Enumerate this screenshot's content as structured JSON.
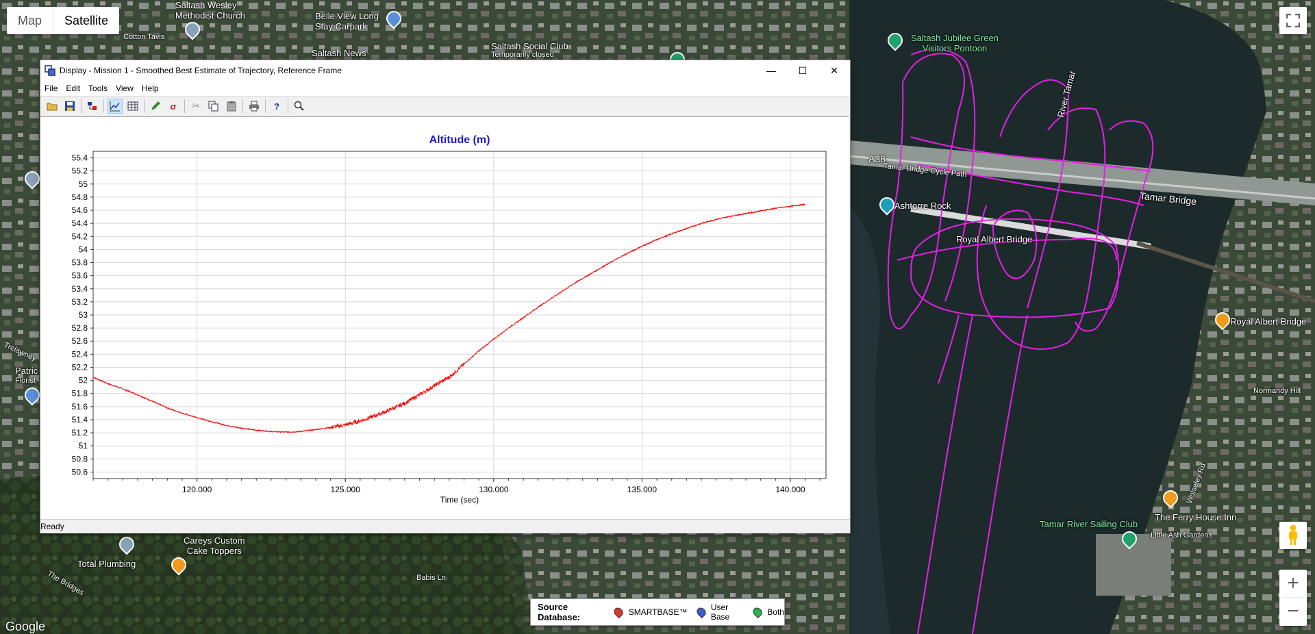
{
  "map": {
    "type_buttons": [
      "Map",
      "Satellite"
    ],
    "attribution": "Google",
    "track_color": "#e81ee8",
    "labels": [
      {
        "text": "Saltash Wesley\nMethodist Church",
        "cls": ""
      },
      {
        "text": "Belle View Long\nStay Carpark",
        "cls": ""
      },
      {
        "text": "Saltash Social Club",
        "cls": ""
      },
      {
        "text": "Temporarily closed",
        "cls": "small"
      },
      {
        "text": "Saltash News",
        "cls": ""
      },
      {
        "text": "Saltash Jubilee Green\nVisitors Pontoon",
        "cls": "green"
      },
      {
        "text": "A38",
        "cls": "road"
      },
      {
        "text": "Tamar Bridge Cycle Path",
        "cls": "small"
      },
      {
        "text": "Tamar Bridge",
        "cls": "road"
      },
      {
        "text": "Ashtorre Rock",
        "cls": ""
      },
      {
        "text": "Royal Albert Bridge",
        "cls": ""
      },
      {
        "text": "River Tamar",
        "cls": ""
      },
      {
        "text": "Royal Albert Bridge",
        "cls": ""
      },
      {
        "text": "Normandy Hill",
        "cls": "small"
      },
      {
        "text": "The Ferry House Inn",
        "cls": ""
      },
      {
        "text": "Tamar River Sailing Club",
        "cls": "green"
      },
      {
        "text": "Little Ash Gardens",
        "cls": "small"
      },
      {
        "text": "Careys Custom\nCake Toppers",
        "cls": ""
      },
      {
        "text": "Total Plumbing",
        "cls": ""
      },
      {
        "text": "Babis Ln",
        "cls": "small"
      },
      {
        "text": "The Bridges",
        "cls": "small"
      },
      {
        "text": "Patric",
        "cls": ""
      },
      {
        "text": "Florist",
        "cls": "small"
      },
      {
        "text": "Trelawney",
        "cls": "small"
      },
      {
        "text": "Wolseley Rd",
        "cls": "small"
      },
      {
        "text": "Cotton Tavis",
        "cls": "small"
      }
    ]
  },
  "legend": {
    "title": "Source Database:",
    "items": [
      {
        "label": "SMARTBASE™",
        "color": "#d9382e"
      },
      {
        "label": "User Base",
        "color": "#3a5fc8"
      },
      {
        "label": "Both",
        "color": "#2fb34a"
      }
    ]
  },
  "window": {
    "title": "Display - Mission 1 - Smoothed Best Estimate of Trajectory, Reference Frame",
    "menu": [
      "File",
      "Edit",
      "Tools",
      "View",
      "Help"
    ],
    "status": "Ready",
    "toolbar_icons": [
      "open-folder-icon",
      "save-icon",
      "layers-icon",
      "line-chart-icon",
      "table-icon",
      "pencil-icon",
      "sigma-icon",
      "cut-icon",
      "copy-icon",
      "paste-icon",
      "print-icon",
      "help-icon",
      "zoom-icon"
    ]
  },
  "chart_data": {
    "type": "line",
    "title": "Altitude (m)",
    "xlabel": "Time (sec)",
    "ylabel": "",
    "xlim": [
      116.5,
      141.2
    ],
    "ylim": [
      50.5,
      55.5
    ],
    "xticks": [
      "120.000",
      "125.000",
      "130.000",
      "135.000",
      "140.000"
    ],
    "xtick_values": [
      120,
      125,
      130,
      135,
      140
    ],
    "yticks": [
      "55.4",
      "55.2",
      "55",
      "54.8",
      "54.6",
      "54.4",
      "54.2",
      "54",
      "53.8",
      "53.6",
      "53.4",
      "53.2",
      "53",
      "52.8",
      "52.6",
      "52.4",
      "52.2",
      "52",
      "51.8",
      "51.6",
      "51.4",
      "51.2",
      "51",
      "50.8",
      "50.6"
    ],
    "ytick_values": [
      55.4,
      55.2,
      55.0,
      54.8,
      54.6,
      54.4,
      54.2,
      54.0,
      53.8,
      53.6,
      53.4,
      53.2,
      53.0,
      52.8,
      52.6,
      52.4,
      52.2,
      52.0,
      51.8,
      51.6,
      51.4,
      51.2,
      51.0,
      50.8,
      50.6
    ],
    "grid": true,
    "series": [
      {
        "color": "#ff0000",
        "x": [
          116.5,
          117.0,
          117.5,
          118.0,
          118.5,
          119.0,
          119.5,
          120.0,
          120.5,
          121.0,
          121.5,
          122.0,
          122.5,
          123.0,
          123.5,
          124.0,
          124.5,
          125.0,
          125.5,
          126.0,
          126.5,
          127.0,
          127.5,
          128.0,
          128.5,
          129.0,
          129.5,
          130.0,
          130.5,
          131.0,
          131.5,
          132.0,
          132.5,
          133.0,
          133.5,
          134.0,
          134.5,
          135.0,
          135.5,
          136.0,
          136.5,
          137.0,
          137.5,
          138.0,
          138.5,
          139.0,
          139.5,
          140.0,
          140.5
        ],
        "y": [
          52.05,
          51.95,
          51.87,
          51.78,
          51.68,
          51.58,
          51.5,
          51.43,
          51.37,
          51.31,
          51.27,
          51.24,
          51.22,
          51.21,
          51.22,
          51.25,
          51.28,
          51.32,
          51.38,
          51.46,
          51.55,
          51.65,
          51.78,
          51.92,
          52.05,
          52.25,
          52.45,
          52.63,
          52.8,
          52.96,
          53.12,
          53.27,
          53.42,
          53.56,
          53.69,
          53.82,
          53.94,
          54.05,
          54.15,
          54.24,
          54.32,
          54.4,
          54.46,
          54.51,
          54.55,
          54.59,
          54.63,
          54.66,
          54.69
        ]
      }
    ]
  }
}
